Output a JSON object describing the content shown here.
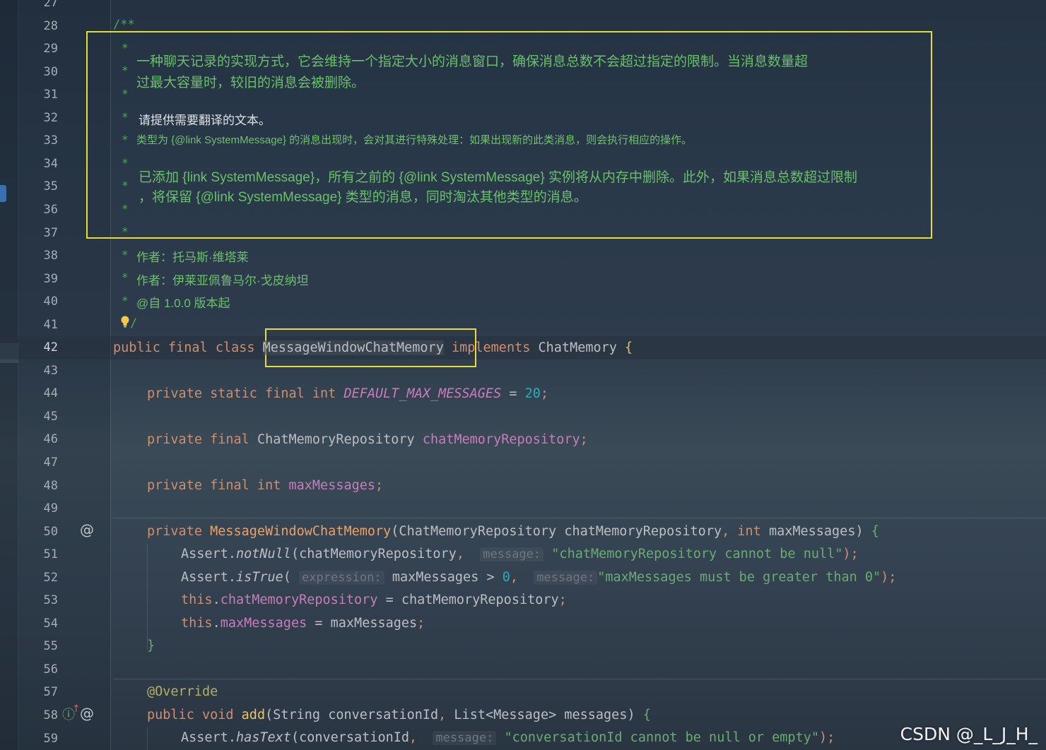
{
  "editor": {
    "line_numbers": [
      "27",
      "28",
      "29",
      "30",
      "31",
      "32",
      "33",
      "34",
      "35",
      "36",
      "37",
      "38",
      "39",
      "40",
      "41",
      "42",
      "43",
      "44",
      "45",
      "46",
      "47",
      "48",
      "49",
      "50",
      "51",
      "52",
      "53",
      "54",
      "55",
      "56",
      "57",
      "58",
      "59"
    ],
    "doc_open": "/**",
    "doc_close": "/",
    "doc": {
      "para1_line1": "一种聊天记录的实现方式，它会维持一个指定大小的消息窗口，确保消息总数不会超过指定的限制。当消息数量超",
      "para1_line2": "过最大容量时，较旧的消息会被删除。",
      "line32": "请提供需要翻译的文本。",
      "line33": "类型为 {@link SystemMessage} 的消息出现时，会对其进行特殊处理：如果出现新的此类消息，则会执行相应的操作。",
      "para2_line1": "已添加 {link SystemMessage}，所有之前的 {@link SystemMessage} 实例将从内存中删除。此外，如果消息总数超过限制",
      "para2_line2": "，将保留 {@link SystemMessage} 类型的消息，同时淘汰其他类型的消息。",
      "author1": "作者：托马斯·维塔莱",
      "author2": "作者：伊莱亚佩鲁马尔·戈皮纳坦",
      "since": "@自 1.0.0 版本起"
    },
    "code": {
      "l42_public": "public",
      "l42_final": "final",
      "l42_class": "class",
      "l42_name": "MessageWindowChatMemory",
      "l42_implements": "implements",
      "l42_iface": "ChatMemory",
      "l42_brace": "{",
      "l44_mods": "private static final int",
      "l44_const": "DEFAULT_MAX_MESSAGES",
      "l44_eq": " = ",
      "l44_val": "20",
      "l46_mods": "private final",
      "l46_type": "ChatMemoryRepository",
      "l46_field": "chatMemoryRepository",
      "l48_mods": "private final int",
      "l48_field": "maxMessages",
      "l50_mod": "private",
      "l50_ctor": "MessageWindowChatMemory",
      "l50_params_a": "(ChatMemoryRepository chatMemoryRepository",
      "l50_int": "int",
      "l50_params_b": "maxMessages)",
      "l50_brace": "{",
      "l51_assert": "Assert.",
      "l51_method": "notNull",
      "l51_arg": "(chatMemoryRepository",
      "l51_hint": "message:",
      "l51_str": "\"chatMemoryRepository cannot be null\"",
      "l51_end": ");",
      "l52_assert": "Assert.",
      "l52_method": "isTrue",
      "l52_open": "(",
      "l52_hint1": "expression:",
      "l52_expr": "maxMessages > ",
      "l52_zero": "0",
      "l52_hint2": "message:",
      "l52_str": "\"maxMessages must be greater than 0\"",
      "l52_end": ");",
      "l53_this": "this",
      "l53_field": "chatMemoryRepository",
      "l53_rhs": " = chatMemoryRepository",
      "l54_this": "this",
      "l54_field": "maxMessages",
      "l54_rhs": " = maxMessages",
      "l55_brace": "}",
      "l57_ann": "@Override",
      "l58_mods": "public void",
      "l58_method": "add",
      "l58_params_a": "(String conversationId",
      "l58_params_b": "List<Message> messages)",
      "l58_brace": "{",
      "l59_assert": "Assert.",
      "l59_method": "hasText",
      "l59_arg": "(conversationId",
      "l59_hint": "message:",
      "l59_str": "\"conversationId cannot be null or empty\"",
      "l59_end": ");"
    }
  },
  "watermark": "CSDN @_L_J_H_",
  "colors": {
    "highlight_box": "#e8dc32",
    "keyword": "#cf8e6d",
    "string": "#6aab73",
    "comment": "#67c267"
  },
  "icons": [
    "bulb-icon",
    "implementation-at-icon",
    "override-icon"
  ]
}
